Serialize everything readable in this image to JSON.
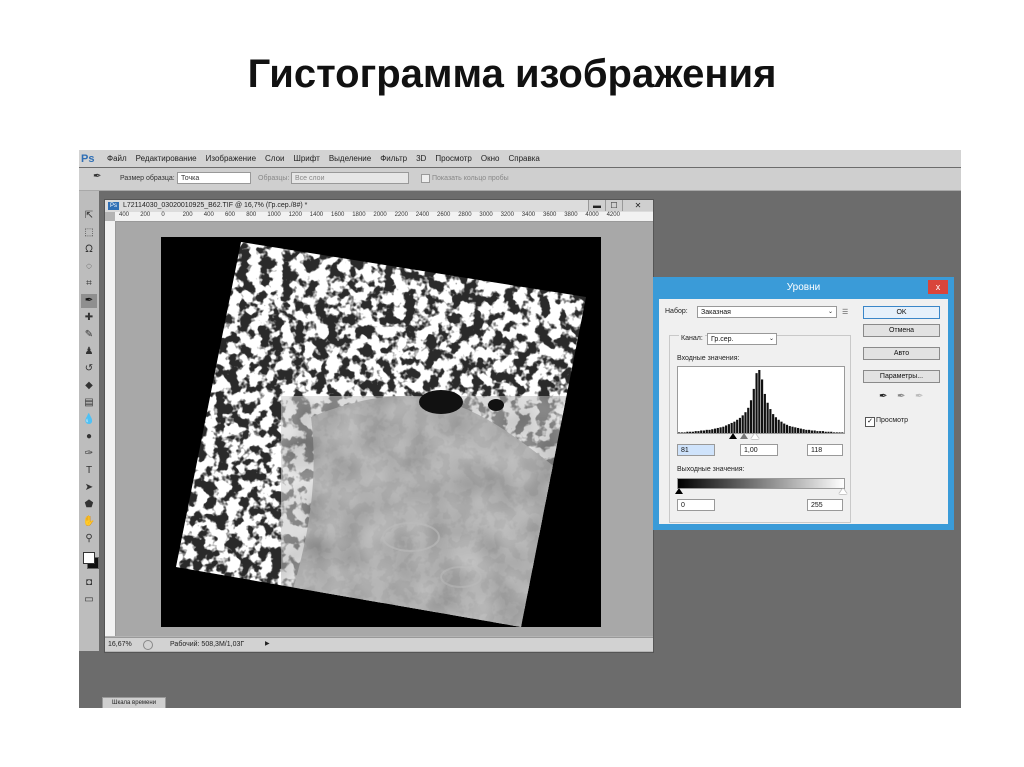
{
  "slide": {
    "title": "Гистограмма изображения"
  },
  "app": {
    "logo": "Ps",
    "menu": [
      "Файл",
      "Редактирование",
      "Изображение",
      "Слои",
      "Шрифт",
      "Выделение",
      "Фильтр",
      "3D",
      "Просмотр",
      "Окно",
      "Справка"
    ]
  },
  "options": {
    "sample_size_label": "Размер образца:",
    "sample_size_value": "Точка",
    "samples_label": "Образцы:",
    "samples_value": "Все слои",
    "show_ring_label": "Показать кольцо пробы"
  },
  "document": {
    "title": "L72114030_03020010925_B62.TIF @ 16,7% (Гр.сер./8#) *",
    "ruler_ticks": [
      "400",
      "200",
      "0",
      "200",
      "400",
      "600",
      "800",
      "1000",
      "1200",
      "1400",
      "1600",
      "1800",
      "2000",
      "2200",
      "2400",
      "2600",
      "2800",
      "3000",
      "3200",
      "3400",
      "3600",
      "3800",
      "4000",
      "4200"
    ],
    "zoom": "16,67%",
    "status": "Рабочий: 508,3M/1,03Г"
  },
  "timeline_tab": "Шкала времени",
  "levels": {
    "title": "Уровни",
    "close_glyph": "x",
    "preset_label": "Набор:",
    "preset_value": "Заказная",
    "channel_label": "Канал:",
    "channel_value": "Гр.сер.",
    "input_label": "Входные значения:",
    "input_black": "81",
    "input_gamma": "1,00",
    "input_white": "118",
    "output_label": "Выходные значения:",
    "output_black": "0",
    "output_white": "255",
    "buttons": {
      "ok": "OK",
      "cancel": "Отмена",
      "auto": "Авто",
      "options": "Параметры..."
    },
    "preview_label": "Просмотр",
    "preview_checked": true,
    "histogram": [
      1,
      1,
      1,
      2,
      2,
      2,
      3,
      3,
      4,
      4,
      5,
      5,
      6,
      7,
      8,
      9,
      10,
      12,
      14,
      16,
      18,
      21,
      24,
      28,
      33,
      40,
      52,
      70,
      95,
      100,
      85,
      62,
      48,
      38,
      30,
      25,
      21,
      18,
      15,
      13,
      11,
      10,
      9,
      8,
      7,
      6,
      5,
      5,
      4,
      4,
      3,
      3,
      3,
      2,
      2,
      2,
      1,
      1,
      1,
      1
    ]
  },
  "colors": {
    "dialog_frame": "#3a9bd8",
    "close_button": "#d9453b",
    "workspace": "#6c6c6c"
  }
}
